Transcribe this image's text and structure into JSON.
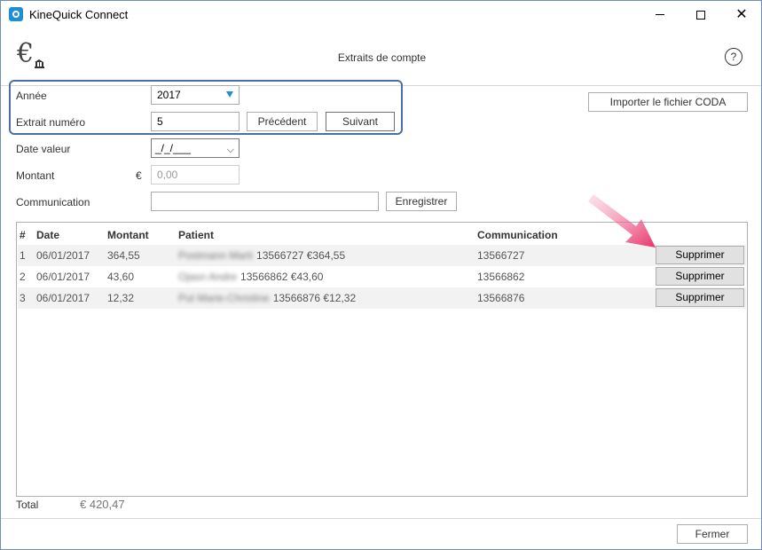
{
  "window": {
    "title": "KineQuick Connect"
  },
  "header": {
    "title": "Extraits de compte",
    "help": "?"
  },
  "form": {
    "annee_label": "Année",
    "annee_value": "2017",
    "extrait_label": "Extrait numéro",
    "extrait_value": "5",
    "precedent_label": "Précédent",
    "suivant_label": "Suivant",
    "import_label": "Importer le fichier CODA",
    "date_valeur_label": "Date valeur",
    "date_valeur_value": "_/_/___",
    "montant_label": "Montant",
    "montant_currency": "€",
    "montant_placeholder": "0,00",
    "communication_label": "Communication",
    "communication_value": "",
    "enregistrer_label": "Enregistrer"
  },
  "table": {
    "headers": {
      "num": "#",
      "date": "Date",
      "montant": "Montant",
      "patient": "Patient",
      "communication": "Communication"
    },
    "delete_label": "Supprimer",
    "rows": [
      {
        "num": "1",
        "date": "06/01/2017",
        "montant": "364,55",
        "patient_name": "Postmann Marti",
        "patient_detail": "13566727 €364,55",
        "communication": "13566727"
      },
      {
        "num": "2",
        "date": "06/01/2017",
        "montant": "43,60",
        "patient_name": "Ojasn Andre",
        "patient_detail": "13566862 €43,60",
        "communication": "13566862"
      },
      {
        "num": "3",
        "date": "06/01/2017",
        "montant": "12,32",
        "patient_name": "Put Marie-Christine",
        "patient_detail": "13566876 €12,32",
        "communication": "13566876"
      }
    ]
  },
  "footer": {
    "total_label": "Total",
    "total_value": "€ 420,47",
    "fermer_label": "Fermer"
  },
  "colors": {
    "accent": "#1e8fd6",
    "highlight_border": "#4a6fa8",
    "arrow": "#e8336a"
  }
}
